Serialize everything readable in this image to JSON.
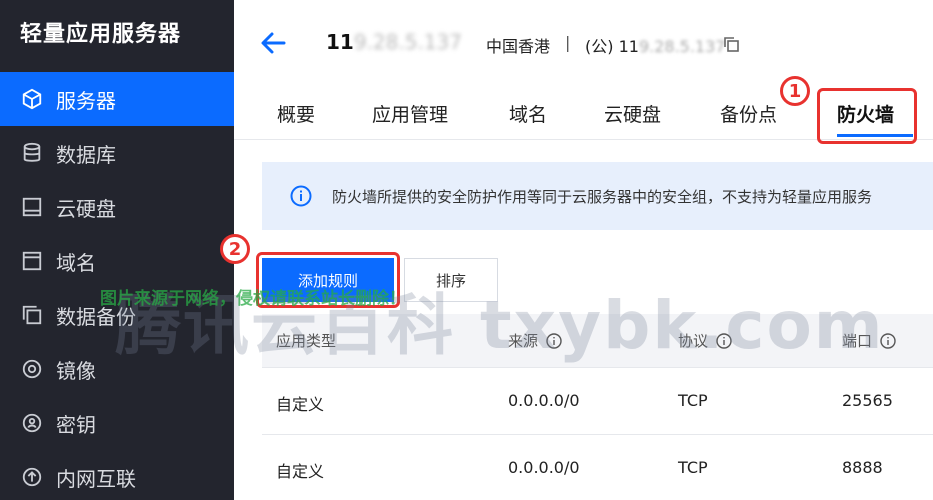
{
  "sidebar": {
    "title": "轻量应用服务器",
    "items": [
      {
        "label": "服务器",
        "icon": "cube-icon",
        "active": true
      },
      {
        "label": "数据库",
        "icon": "database-icon",
        "active": false
      },
      {
        "label": "云硬盘",
        "icon": "disk-icon",
        "active": false
      },
      {
        "label": "域名",
        "icon": "domain-icon",
        "active": false
      },
      {
        "label": "数据备份",
        "icon": "backup-icon",
        "active": false
      },
      {
        "label": "镜像",
        "icon": "image-icon",
        "active": false
      },
      {
        "label": "密钥",
        "icon": "key-icon",
        "active": false
      },
      {
        "label": "内网互联",
        "icon": "network-icon",
        "active": false
      }
    ]
  },
  "header": {
    "server_id_prefix": "11",
    "server_id_blurred": "9.28.5.137",
    "region": "中国香港",
    "separator": "|",
    "public_ip_prefix": "(公) 11",
    "public_ip_blurred": "9.28.5.137"
  },
  "tabs": [
    "概要",
    "应用管理",
    "域名",
    "云硬盘",
    "备份点",
    "防火墙"
  ],
  "annotations": {
    "step1": "1",
    "step2": "2"
  },
  "info_banner": {
    "text": "防火墙所提供的安全防护作用等同于云服务器中的安全组，不支持为轻量应用服务"
  },
  "buttons": {
    "add_rule": "添加规则",
    "sort": "排序"
  },
  "watermark": {
    "big": "腾讯云百科 txybk.com",
    "small": "图片来源于网络，侵权请联系站长删除！"
  },
  "table": {
    "columns": [
      "应用类型",
      "来源",
      "协议",
      "端口"
    ],
    "rows": [
      [
        "自定义",
        "0.0.0.0/0",
        "TCP",
        "25565"
      ],
      [
        "自定义",
        "0.0.0.0/0",
        "TCP",
        "8888"
      ]
    ]
  },
  "colors": {
    "sidebar_bg": "#23252e",
    "accent": "#0b6bff",
    "annotation": "#e8322f",
    "banner_bg": "#e7effc"
  }
}
